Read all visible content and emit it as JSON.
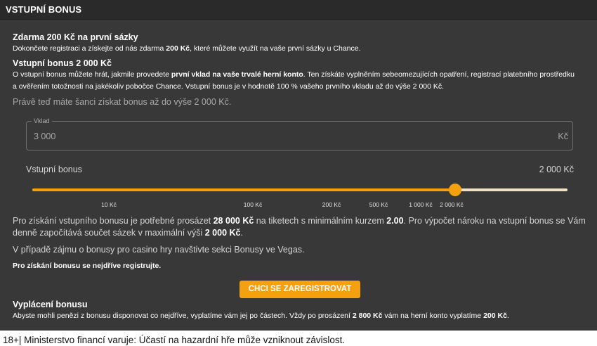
{
  "header": {
    "title": "VSTUPNÍ BONUS"
  },
  "free_section": {
    "title": "Zdarma 200 Kč na první sázky",
    "text_1": "Dokončete registraci a získejte od nás zdarma ",
    "text_bold": "200 Kč",
    "text_2": ", které můžete využít na vaše první sázky u Chance."
  },
  "entry_section": {
    "title": "Vstupní bonus 2 000 Kč",
    "line1_a": "O vstupní bonus můžete hrát, jakmile provedete ",
    "line1_bold": "první vklad na vaše trvalé herní konto",
    "line1_b": ". Ten získáte vyplněním sebeomezujících opatření, registrací platebního prostředku",
    "line2": "a ověřením totožnosti na jakékoliv pobočce Chance. Vstupní bonus je v hodnotě 100 % vašeho prvního vkladu až do výše 2 000 Kč."
  },
  "chance_text": "Právě teď máte šanci získat bonus až do výše 2 000 Kč.",
  "deposit": {
    "legend": "Vklad",
    "value": "3 000",
    "suffix": "Kč"
  },
  "bonus_row": {
    "label": "Vstupní bonus",
    "value": "2 000 Kč"
  },
  "slider": {
    "level_fraction": 0.79,
    "ticks": [
      "10 Kč",
      "100 Kč",
      "200 Kč",
      "500 Kč",
      "1 000 Kč",
      "2 000 Kč"
    ],
    "accent": "#f5a00f",
    "rest": "#efe1c2"
  },
  "wager": {
    "a": "Pro získání vstupního bonusu je potřebné prosázet ",
    "b": "28 000 Kč",
    "c": " na tiketech s minimálním kurzem ",
    "d": "2.00",
    "e": ". Pro výpočet nároku na vstupní bonus se Vám",
    "f": "denně započítává součet sázek v maximální výši ",
    "g": "2 000 Kč",
    "h": "."
  },
  "casino_text": "V případě zájmu o bonusy pro casino hry navštivte sekci Bonusy ve Vegas.",
  "register_note": "Pro získání bonusu se nejdříve registrujte.",
  "cta": {
    "label": "CHCI SE ZAREGISTROVAT"
  },
  "payout": {
    "title": "Vyplácení bonusu",
    "a": "Abyste mohli penězi z bonusu disponovat co nejdříve, vyplatíme vám jej po částech. Vždy po prosázení ",
    "b": "2 800 Kč",
    "c": " vám na herní konto vyplatíme ",
    "d": "200 Kč",
    "e": "."
  },
  "footer": "18+| Ministerstvo financí varuje: Účastí na hazardní hře může vzniknout závislost.",
  "colors": {
    "accent": "#f5a00f",
    "panel": "#383838",
    "header": "#2a2a2a"
  }
}
